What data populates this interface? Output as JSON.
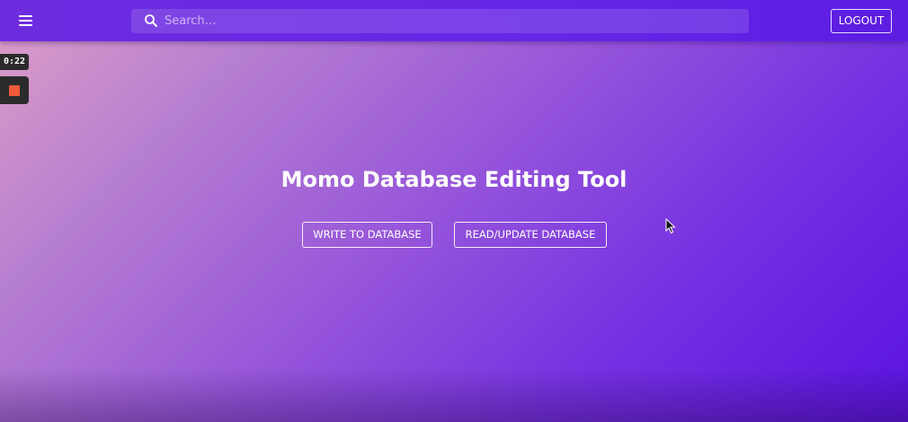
{
  "appbar": {
    "menu_icon": "hamburger-menu-icon",
    "search": {
      "icon": "search-icon",
      "placeholder": "Search…",
      "value": ""
    },
    "logout_label": "LOGOUT"
  },
  "recorder": {
    "time": "0:22",
    "stop_icon": "stop-icon"
  },
  "hero": {
    "title": "Momo Database Editing Tool",
    "buttons": {
      "write_label": "WRITE TO DATABASE",
      "read_update_label": "READ/UPDATE DATABASE"
    }
  },
  "colors": {
    "appbar": "#6a29e3",
    "gradient_start": "#dea0c6",
    "gradient_end": "#5a12e0",
    "recorder_bg": "#2b2b2b",
    "stop_red": "#ef5a3a"
  }
}
